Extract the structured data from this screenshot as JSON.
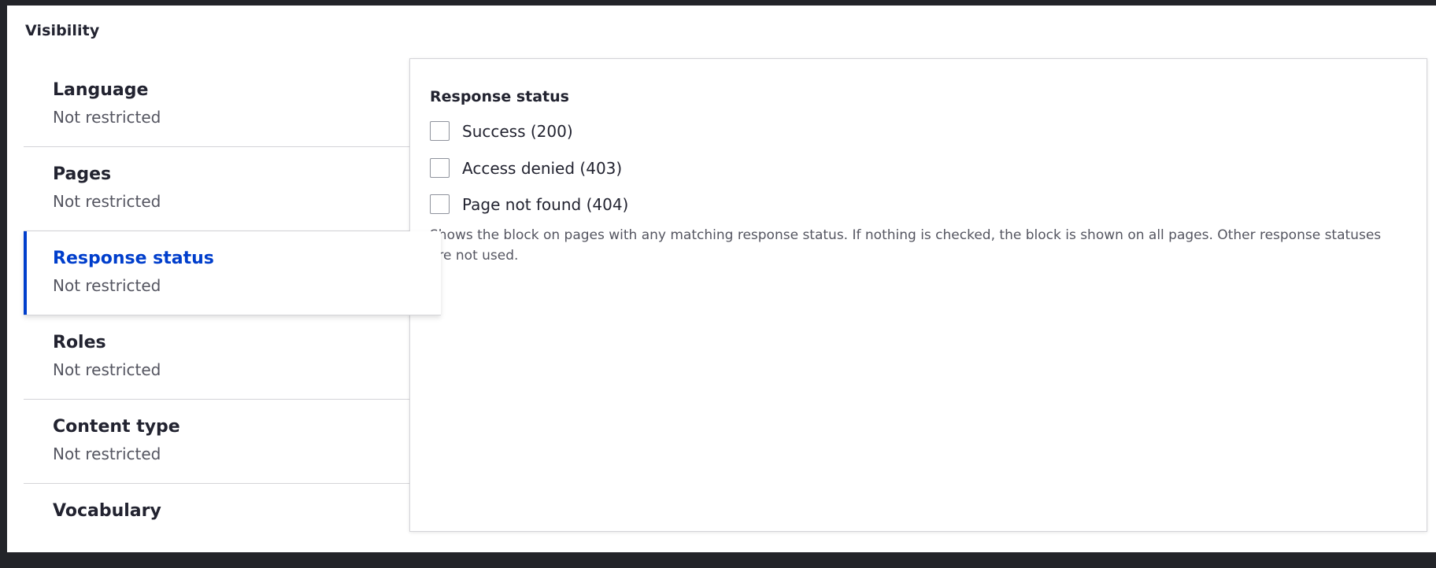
{
  "section": {
    "title": "Visibility"
  },
  "tabs": [
    {
      "title": "Language",
      "summary": "Not restricted",
      "active": false
    },
    {
      "title": "Pages",
      "summary": "Not restricted",
      "active": false
    },
    {
      "title": "Response status",
      "summary": "Not restricted",
      "active": true
    },
    {
      "title": "Roles",
      "summary": "Not restricted",
      "active": false
    },
    {
      "title": "Content type",
      "summary": "Not restricted",
      "active": false
    },
    {
      "title": "Vocabulary",
      "summary": "",
      "active": false
    }
  ],
  "pane": {
    "legend": "Response status",
    "options": [
      {
        "label": "Success (200)",
        "checked": false
      },
      {
        "label": "Access denied (403)",
        "checked": false
      },
      {
        "label": "Page not found (404)",
        "checked": false
      }
    ],
    "description": "Shows the block on pages with any matching response status. If nothing is checked, the block is shown on all pages. Other response statuses are not used."
  },
  "colors": {
    "accent": "#003ecc",
    "text": "#222330",
    "muted": "#545560",
    "border": "#d4d4d8",
    "outer_background": "#232429"
  }
}
